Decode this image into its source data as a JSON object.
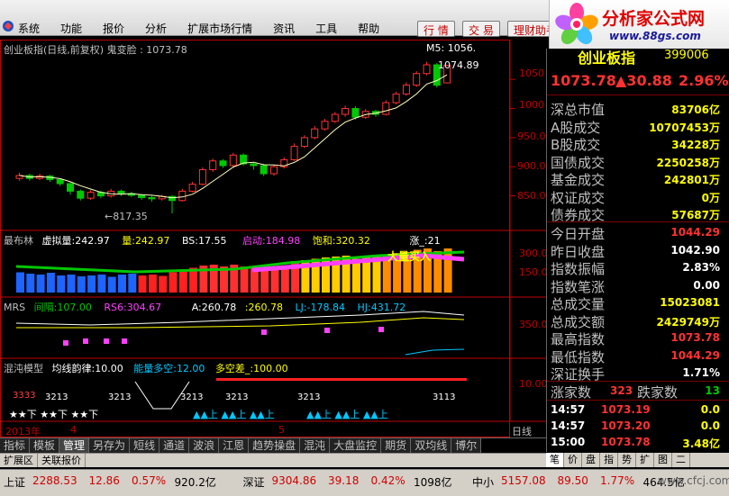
{
  "colors": {
    "up": "#ff3232",
    "down": "#00c800",
    "ma": "#ffffc0",
    "axis": "#c00000",
    "label": "#ffff00"
  },
  "menu": [
    "系统",
    "功能",
    "报价",
    "分析",
    "扩展市场行情",
    "资讯",
    "工具",
    "帮助"
  ],
  "top_buttons": [
    "行 情",
    "交 易",
    "理财助手"
  ],
  "site_logo": {
    "title": "分析家公式网",
    "url": "www.88gs.com"
  },
  "main_chart": {
    "title": "创业板指(日线,前复权) 鬼变脸 : 1073.78",
    "ma_label": "M5: 1056.",
    "price_note": "1074.89",
    "low_note": "←817.35",
    "y_ticks": [
      "1050",
      "1000",
      "950.0",
      "900.0",
      "850.0"
    ],
    "y_ticks_values": [
      1050,
      1000,
      950,
      900,
      850
    ]
  },
  "sub1": {
    "name": "最布林",
    "items": [
      {
        "label": "虚拟量:",
        "value": "242.97",
        "color": "#ffffff"
      },
      {
        "label": "量:",
        "value": "242.97",
        "color": "#ffff00"
      },
      {
        "label": "BS:",
        "value": "17.55",
        "color": "#ffffff"
      },
      {
        "label": "启动:",
        "value": "184.98",
        "color": "#ff40ff"
      },
      {
        "label": "饱和:",
        "value": "320.32",
        "color": "#ffff00"
      },
      {
        "label": "涨_:",
        "value": "21",
        "color": "#ffffff"
      }
    ],
    "y_ticks": [
      "300.0",
      "150.0"
    ],
    "note": "大量买入"
  },
  "sub2": {
    "name": "MRS",
    "items": [
      {
        "label": "间隔:",
        "value": "107.00",
        "color": "#00c800"
      },
      {
        "label": "RS6:",
        "value": "304.67",
        "color": "#ff40ff"
      },
      {
        "label": "A:",
        "value": "260.78",
        "color": "#ffffff"
      },
      {
        "label": ":",
        "value": "260.78",
        "color": "#ffff00"
      },
      {
        "label": "LJ:",
        "value": "-178.84",
        "color": "#00c8ff"
      },
      {
        "label": "HJ:",
        "value": "431.72",
        "color": "#00c8ff"
      }
    ],
    "y_ticks": [
      "350.0"
    ]
  },
  "sub3": {
    "name": "混沌模型",
    "items": [
      {
        "label": "均线韵律:",
        "value": "10.00",
        "color": "#ffffff"
      },
      {
        "label": "能量多空:",
        "value": "12.00",
        "color": "#00c8ff"
      },
      {
        "label": "多空差_:",
        "value": "100.00",
        "color": "#ffff00"
      }
    ],
    "y_ticks": [
      "10.00"
    ],
    "signal_nums": [
      "3333",
      "3213",
      "3213",
      "3213",
      "3213",
      "3213",
      "3113"
    ],
    "bottom_marks": "★★下 ★★下 ★★下",
    "up_marks": "▲▲上 ▲▲上 ▲▲上"
  },
  "x_axis": {
    "labels": [
      "2013年",
      "4",
      "5"
    ],
    "period": "日线"
  },
  "tabs": [
    "指标",
    "模板",
    "管理",
    "另存为",
    "短线",
    "通道",
    "波浪",
    "江恩",
    "趋势操盘",
    "混沌",
    "大盘监控",
    "期货",
    "双均线",
    "博尔"
  ],
  "tab_active": "管理",
  "sub_tabs": [
    "扩展区",
    "关联报价"
  ],
  "right_tabs": [
    "笔",
    "价",
    "盘",
    "指",
    "势",
    "扩",
    "图",
    "二"
  ],
  "right_tab_active": "笔",
  "quote": {
    "name": "创业板指",
    "code": "399006",
    "price": "1073.78",
    "change": "▲30.88",
    "change_pct": "2.96%"
  },
  "stats": [
    {
      "k": "深总市值",
      "v": "83706亿"
    },
    {
      "k": "A股成交",
      "v": "10707453万"
    },
    {
      "k": "B股成交",
      "v": "34228万"
    },
    {
      "k": "国债成交",
      "v": "2250258万"
    },
    {
      "k": "基金成交",
      "v": "242801万"
    },
    {
      "k": "权证成交",
      "v": "0万"
    },
    {
      "k": "债券成交",
      "v": "57687万"
    }
  ],
  "stats2": [
    {
      "k": "今日开盘",
      "v": "1044.29",
      "c": "#ff3232"
    },
    {
      "k": "昨日收盘",
      "v": "1042.90",
      "c": "#ffffff"
    },
    {
      "k": "指数振幅",
      "v": "2.83%",
      "c": "#ffffff"
    },
    {
      "k": "指数笔涨",
      "v": "0.00",
      "c": "#ffffff"
    },
    {
      "k": "总成交量",
      "v": "15023081",
      "c": "#ffff00"
    },
    {
      "k": "总成交额",
      "v": "2429749万",
      "c": "#ffff00"
    },
    {
      "k": "最高指数",
      "v": "1073.78",
      "c": "#ff3232"
    },
    {
      "k": "最低指数",
      "v": "1044.29",
      "c": "#ff3232"
    },
    {
      "k": "深证换手",
      "v": "1.71%",
      "c": "#ffffff"
    }
  ],
  "adv_dec": {
    "up_label": "涨家数",
    "up": "323",
    "down_label": "跌家数",
    "down": "13"
  },
  "ticks": [
    {
      "t": "14:57",
      "p": "1073.19",
      "v": "0.0",
      "vc": "#ffff00"
    },
    {
      "t": "14:57",
      "p": "1073.20",
      "v": "0.0",
      "vc": "#ffff00"
    },
    {
      "t": "15:00",
      "p": "1073.78",
      "v": "3.48亿",
      "vc": "#ffff00"
    }
  ],
  "status": [
    {
      "t": "上证",
      "c": ""
    },
    {
      "t": "2288.53",
      "c": "r"
    },
    {
      "t": "12.86",
      "c": "r"
    },
    {
      "t": "0.57%",
      "c": "r"
    },
    {
      "t": "920.2亿",
      "c": ""
    },
    {
      "t": "深证",
      "c": ""
    },
    {
      "t": "9304.86",
      "c": "r"
    },
    {
      "t": "39.18",
      "c": "r"
    },
    {
      "t": "0.42%",
      "c": "r"
    },
    {
      "t": "1098亿",
      "c": ""
    },
    {
      "t": "中小",
      "c": ""
    },
    {
      "t": "5157.08",
      "c": "r"
    },
    {
      "t": "89.50",
      "c": "r"
    },
    {
      "t": "1.77%",
      "c": "r"
    },
    {
      "t": "464.5亿",
      "c": ""
    }
  ],
  "watermark": "www.cfcj.com",
  "candles": [
    {
      "o": 880,
      "c": 885,
      "h": 890,
      "l": 876
    },
    {
      "o": 885,
      "c": 880,
      "h": 888,
      "l": 876
    },
    {
      "o": 880,
      "c": 884,
      "h": 888,
      "l": 877
    },
    {
      "o": 884,
      "c": 878,
      "h": 886,
      "l": 874
    },
    {
      "o": 878,
      "c": 871,
      "h": 880,
      "l": 867
    },
    {
      "o": 871,
      "c": 858,
      "h": 873,
      "l": 852
    },
    {
      "o": 858,
      "c": 846,
      "h": 861,
      "l": 842
    },
    {
      "o": 846,
      "c": 856,
      "h": 860,
      "l": 843
    },
    {
      "o": 856,
      "c": 850,
      "h": 859,
      "l": 846
    },
    {
      "o": 850,
      "c": 858,
      "h": 862,
      "l": 847
    },
    {
      "o": 858,
      "c": 854,
      "h": 861,
      "l": 850
    },
    {
      "o": 854,
      "c": 851,
      "h": 857,
      "l": 848
    },
    {
      "o": 851,
      "c": 847,
      "h": 853,
      "l": 843
    },
    {
      "o": 847,
      "c": 845,
      "h": 850,
      "l": 840
    },
    {
      "o": 845,
      "c": 849,
      "h": 852,
      "l": 842
    },
    {
      "o": 849,
      "c": 842,
      "h": 851,
      "l": 820
    },
    {
      "o": 842,
      "c": 858,
      "h": 862,
      "l": 840
    },
    {
      "o": 858,
      "c": 870,
      "h": 874,
      "l": 856
    },
    {
      "o": 870,
      "c": 895,
      "h": 899,
      "l": 868
    },
    {
      "o": 895,
      "c": 910,
      "h": 914,
      "l": 891
    },
    {
      "o": 910,
      "c": 902,
      "h": 913,
      "l": 898
    },
    {
      "o": 902,
      "c": 920,
      "h": 924,
      "l": 900
    },
    {
      "o": 920,
      "c": 905,
      "h": 923,
      "l": 902
    },
    {
      "o": 905,
      "c": 902,
      "h": 908,
      "l": 895
    },
    {
      "o": 902,
      "c": 888,
      "h": 905,
      "l": 884
    },
    {
      "o": 888,
      "c": 900,
      "h": 904,
      "l": 885
    },
    {
      "o": 900,
      "c": 912,
      "h": 916,
      "l": 897
    },
    {
      "o": 912,
      "c": 935,
      "h": 940,
      "l": 910
    },
    {
      "o": 935,
      "c": 950,
      "h": 954,
      "l": 932
    },
    {
      "o": 950,
      "c": 965,
      "h": 970,
      "l": 947
    },
    {
      "o": 965,
      "c": 978,
      "h": 982,
      "l": 962
    },
    {
      "o": 978,
      "c": 990,
      "h": 994,
      "l": 975
    },
    {
      "o": 990,
      "c": 1000,
      "h": 1005,
      "l": 986
    },
    {
      "o": 1000,
      "c": 985,
      "h": 1004,
      "l": 981
    },
    {
      "o": 985,
      "c": 995,
      "h": 999,
      "l": 982
    },
    {
      "o": 995,
      "c": 990,
      "h": 998,
      "l": 986
    },
    {
      "o": 990,
      "c": 1010,
      "h": 1014,
      "l": 988
    },
    {
      "o": 1010,
      "c": 1025,
      "h": 1029,
      "l": 1007
    },
    {
      "o": 1025,
      "c": 1040,
      "h": 1045,
      "l": 1022
    },
    {
      "o": 1040,
      "c": 1060,
      "h": 1064,
      "l": 1037
    },
    {
      "o": 1060,
      "c": 1075,
      "h": 1080,
      "l": 1057
    },
    {
      "o": 1075,
      "c": 1040,
      "h": 1078,
      "l": 1036
    },
    {
      "o": 1044,
      "c": 1074,
      "h": 1075,
      "l": 1043
    }
  ]
}
